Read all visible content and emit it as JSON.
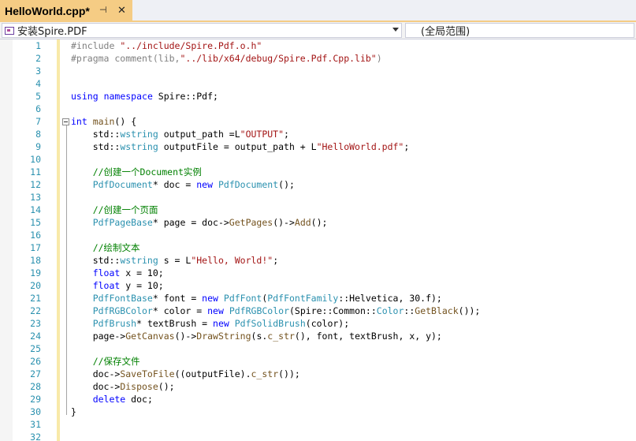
{
  "tab": {
    "title": "HelloWorld.cpp*",
    "pin_glyph": "⊣",
    "close_glyph": "✕"
  },
  "navbar": {
    "scope": "安装Spire.PDF",
    "scope_icon": "class-icon",
    "member": "(全局范围)"
  },
  "editor": {
    "line_count": 32,
    "lines": [
      [
        [
          "pp",
          "#include "
        ],
        [
          "str",
          "\"../include/Spire.Pdf.o.h\""
        ]
      ],
      [
        [
          "pp",
          "#pragma comment(lib,"
        ],
        [
          "str",
          "\"../lib/x64/debug/Spire.Pdf.Cpp.lib\""
        ],
        [
          "pp",
          ")"
        ]
      ],
      [],
      [],
      [
        [
          "kw",
          "using"
        ],
        [
          "def",
          " "
        ],
        [
          "kw",
          "namespace"
        ],
        [
          "def",
          " Spire::Pdf;"
        ]
      ],
      [],
      [
        [
          "kw",
          "int"
        ],
        [
          "def",
          " "
        ],
        [
          "fn",
          "main"
        ],
        [
          "def",
          "() {"
        ]
      ],
      [
        [
          "def",
          "    std::"
        ],
        [
          "type",
          "wstring"
        ],
        [
          "def",
          " output_path =L"
        ],
        [
          "str",
          "\"OUTPUT\""
        ],
        [
          "def",
          ";"
        ]
      ],
      [
        [
          "def",
          "    std::"
        ],
        [
          "type",
          "wstring"
        ],
        [
          "def",
          " outputFile = output_path + L"
        ],
        [
          "str",
          "\"HelloWorld.pdf\""
        ],
        [
          "def",
          ";"
        ]
      ],
      [],
      [
        [
          "cm",
          "    //创建一个Document实例"
        ]
      ],
      [
        [
          "type",
          "    PdfDocument"
        ],
        [
          "def",
          "* doc = "
        ],
        [
          "kw",
          "new"
        ],
        [
          "def",
          " "
        ],
        [
          "type",
          "PdfDocument"
        ],
        [
          "def",
          "();"
        ]
      ],
      [],
      [
        [
          "cm",
          "    //创建一个页面"
        ]
      ],
      [
        [
          "type",
          "    PdfPageBase"
        ],
        [
          "def",
          "* page = doc->"
        ],
        [
          "fn",
          "GetPages"
        ],
        [
          "def",
          "()->"
        ],
        [
          "fn",
          "Add"
        ],
        [
          "def",
          "();"
        ]
      ],
      [],
      [
        [
          "cm",
          "    //绘制文本"
        ]
      ],
      [
        [
          "def",
          "    std::"
        ],
        [
          "type",
          "wstring"
        ],
        [
          "def",
          " s = L"
        ],
        [
          "str",
          "\"Hello, World!\""
        ],
        [
          "def",
          ";"
        ]
      ],
      [
        [
          "kw",
          "    float"
        ],
        [
          "def",
          " x = 10;"
        ]
      ],
      [
        [
          "kw",
          "    float"
        ],
        [
          "def",
          " y = 10;"
        ]
      ],
      [
        [
          "type",
          "    PdfFontBase"
        ],
        [
          "def",
          "* font = "
        ],
        [
          "kw",
          "new"
        ],
        [
          "def",
          " "
        ],
        [
          "type",
          "PdfFont"
        ],
        [
          "def",
          "("
        ],
        [
          "type",
          "PdfFontFamily"
        ],
        [
          "def",
          "::Helvetica, 30.f);"
        ]
      ],
      [
        [
          "type",
          "    PdfRGBColor"
        ],
        [
          "def",
          "* color = "
        ],
        [
          "kw",
          "new"
        ],
        [
          "def",
          " "
        ],
        [
          "type",
          "PdfRGBColor"
        ],
        [
          "def",
          "(Spire::Common::"
        ],
        [
          "type",
          "Color"
        ],
        [
          "def",
          "::"
        ],
        [
          "fn",
          "GetBlack"
        ],
        [
          "def",
          "());"
        ]
      ],
      [
        [
          "type",
          "    PdfBrush"
        ],
        [
          "def",
          "* textBrush = "
        ],
        [
          "kw",
          "new"
        ],
        [
          "def",
          " "
        ],
        [
          "type",
          "PdfSolidBrush"
        ],
        [
          "def",
          "(color);"
        ]
      ],
      [
        [
          "def",
          "    page->"
        ],
        [
          "fn",
          "GetCanvas"
        ],
        [
          "def",
          "()->"
        ],
        [
          "fn",
          "DrawString"
        ],
        [
          "def",
          "(s."
        ],
        [
          "fn",
          "c_str"
        ],
        [
          "def",
          "(), font, textBrush, x, y);"
        ]
      ],
      [],
      [
        [
          "cm",
          "    //保存文件"
        ]
      ],
      [
        [
          "def",
          "    doc->"
        ],
        [
          "fn",
          "SaveToFile"
        ],
        [
          "def",
          "((outputFile)."
        ],
        [
          "fn",
          "c_str"
        ],
        [
          "def",
          "());"
        ]
      ],
      [
        [
          "def",
          "    doc->"
        ],
        [
          "fn",
          "Dispose"
        ],
        [
          "def",
          "();"
        ]
      ],
      [
        [
          "kw",
          "    delete"
        ],
        [
          "def",
          " doc;"
        ]
      ],
      [
        [
          "def",
          "}"
        ]
      ],
      [],
      []
    ]
  },
  "colors": {
    "tab_active": "#f5cc84",
    "line_number": "#2b91af",
    "keyword": "#0000ff",
    "type": "#2b91af",
    "string": "#a31515",
    "comment": "#008000",
    "preprocessor": "#808080",
    "function": "#74531f"
  }
}
